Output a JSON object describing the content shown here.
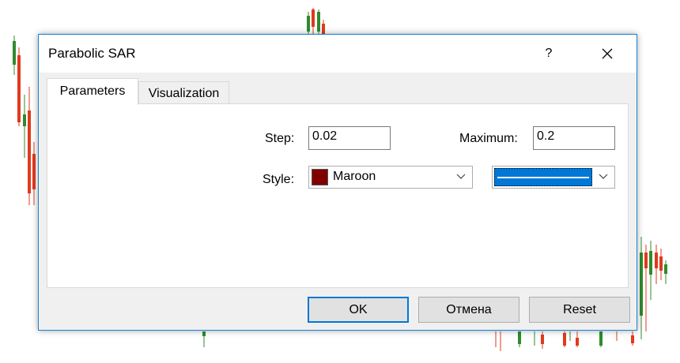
{
  "dialog": {
    "title": "Parabolic SAR",
    "help_label": "?",
    "close_label": "✕"
  },
  "tabs": [
    {
      "label": "Parameters",
      "active": true
    },
    {
      "label": "Visualization",
      "active": false
    }
  ],
  "parameters": {
    "step_label": "Step:",
    "step_value": "0.02",
    "maximum_label": "Maximum:",
    "maximum_value": "0.2",
    "style_label": "Style:",
    "color_name": "Maroon",
    "color_hex": "#800000",
    "line_color": "#0078d7",
    "accent_color": "#0078d7"
  },
  "buttons": {
    "ok": "OK",
    "cancel": "Отмена",
    "reset": "Reset"
  }
}
